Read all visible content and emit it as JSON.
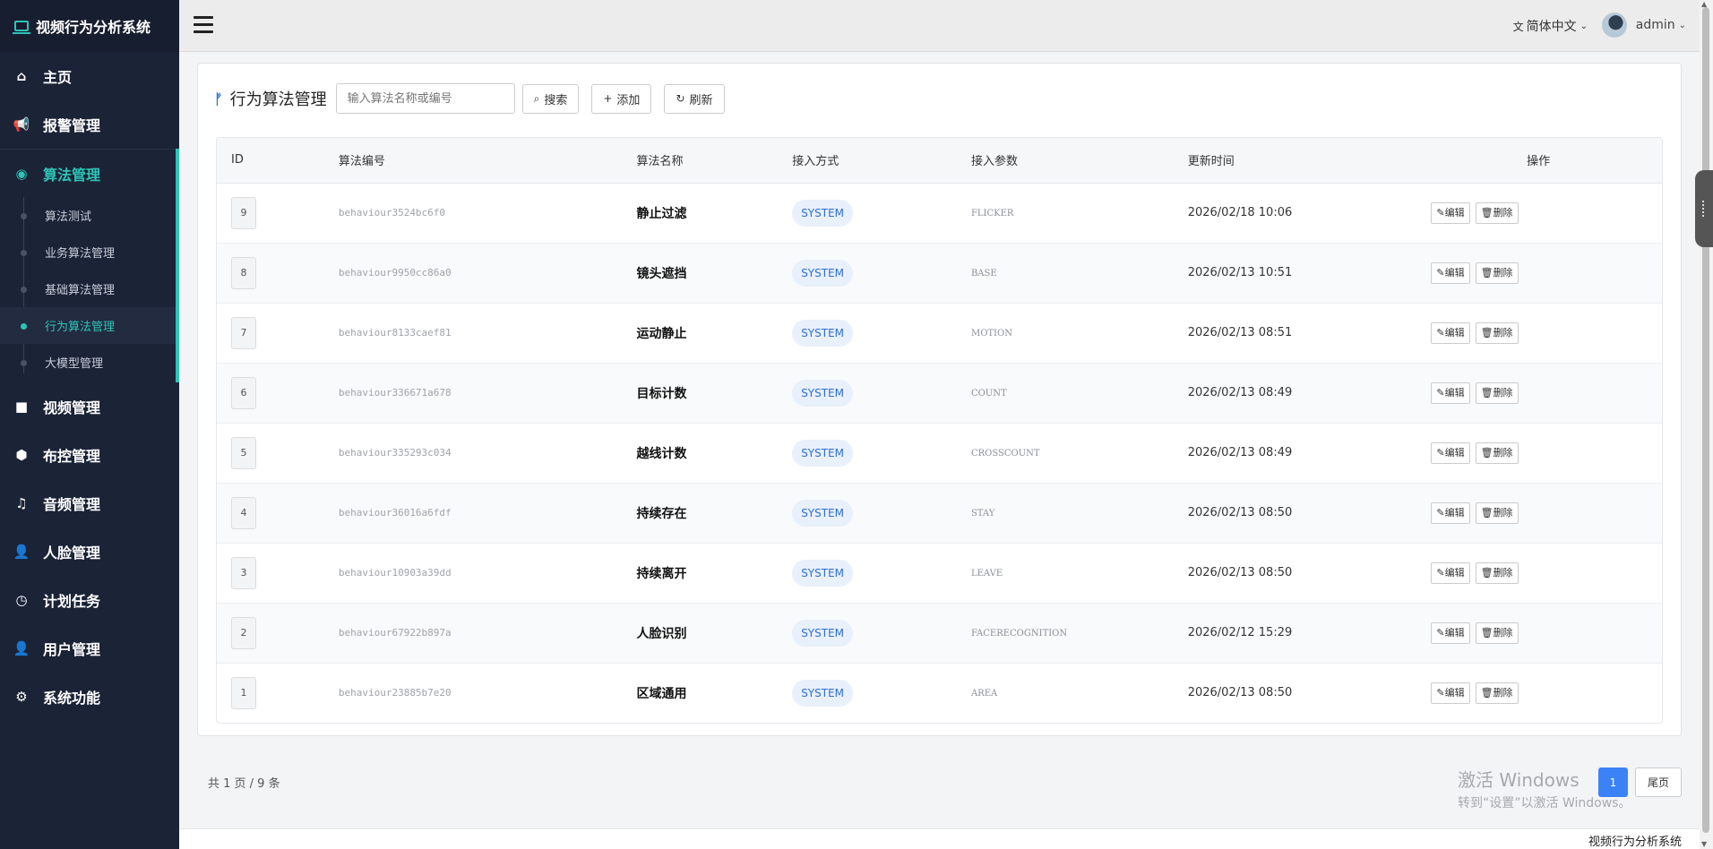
{
  "app": {
    "title": "视频行为分析系统"
  },
  "sidebar": {
    "items": [
      {
        "label": "主页",
        "icon": "home-icon",
        "glyph": "⌂"
      },
      {
        "label": "报警管理",
        "icon": "bullhorn-icon",
        "glyph": "📢"
      },
      {
        "label": "算法管理",
        "icon": "eye-icon",
        "glyph": "◉"
      },
      {
        "label": "视频管理",
        "icon": "video-camera-icon",
        "glyph": "■"
      },
      {
        "label": "布控管理",
        "icon": "cube-icon",
        "glyph": "⬢"
      },
      {
        "label": "音频管理",
        "icon": "music-icon",
        "glyph": "♫"
      },
      {
        "label": "人脸管理",
        "icon": "user-add-icon",
        "glyph": "👤"
      },
      {
        "label": "计划任务",
        "icon": "clock-icon",
        "glyph": "◷"
      },
      {
        "label": "用户管理",
        "icon": "user-icon",
        "glyph": "👤"
      },
      {
        "label": "系统功能",
        "icon": "gear-icon",
        "glyph": "⚙"
      }
    ],
    "sub_items": [
      "算法测试",
      "业务算法管理",
      "基础算法管理",
      "行为算法管理",
      "大模型管理"
    ]
  },
  "header": {
    "language": "简体中文",
    "user": "admin"
  },
  "page": {
    "title": "行为算法管理",
    "search_placeholder": "输入算法名称或编号",
    "search_label": "搜索",
    "add_label": "添加",
    "refresh_label": "刷新"
  },
  "table": {
    "columns": [
      "ID",
      "算法编号",
      "算法名称",
      "接入方式",
      "接入参数",
      "更新时间",
      "操作"
    ],
    "edit_label": "编辑",
    "delete_label": "删除",
    "rows": [
      {
        "id": "9",
        "code": "behaviour3524bc6f0",
        "name": "静止过滤",
        "method": "SYSTEM",
        "param": "FLICKER",
        "time": "2026/02/18 10:06"
      },
      {
        "id": "8",
        "code": "behaviour9950cc86a0",
        "name": "镜头遮挡",
        "method": "SYSTEM",
        "param": "BASE",
        "time": "2026/02/13 10:51"
      },
      {
        "id": "7",
        "code": "behaviour8133caef81",
        "name": "运动静止",
        "method": "SYSTEM",
        "param": "MOTION",
        "time": "2026/02/13 08:51"
      },
      {
        "id": "6",
        "code": "behaviour336671a678",
        "name": "目标计数",
        "method": "SYSTEM",
        "param": "COUNT",
        "time": "2026/02/13 08:49"
      },
      {
        "id": "5",
        "code": "behaviour335293c034",
        "name": "越线计数",
        "method": "SYSTEM",
        "param": "CROSSCOUNT",
        "time": "2026/02/13 08:49"
      },
      {
        "id": "4",
        "code": "behaviour36016a6fdf",
        "name": "持续存在",
        "method": "SYSTEM",
        "param": "STAY",
        "time": "2026/02/13 08:50"
      },
      {
        "id": "3",
        "code": "behaviour10903a39dd",
        "name": "持续离开",
        "method": "SYSTEM",
        "param": "LEAVE",
        "time": "2026/02/13 08:50"
      },
      {
        "id": "2",
        "code": "behaviour67922b897a",
        "name": "人脸识别",
        "method": "SYSTEM",
        "param": "FACERECOGNITION",
        "time": "2026/02/12 15:29"
      },
      {
        "id": "1",
        "code": "behaviour23885b7e20",
        "name": "区域通用",
        "method": "SYSTEM",
        "param": "AREA",
        "time": "2026/02/13 08:50"
      }
    ]
  },
  "pagination": {
    "info": "共 1 页 / 9 条",
    "current": "1",
    "last_label": "尾页"
  },
  "watermark": {
    "line1": "激活 Windows",
    "line2": "转到“设置”以激活 Windows。"
  },
  "footer": {
    "text": "视频行为分析系统"
  },
  "colors": {
    "sidebar_bg": "#1b2337",
    "accent": "#2ec4b6",
    "primary": "#3b82f6"
  }
}
